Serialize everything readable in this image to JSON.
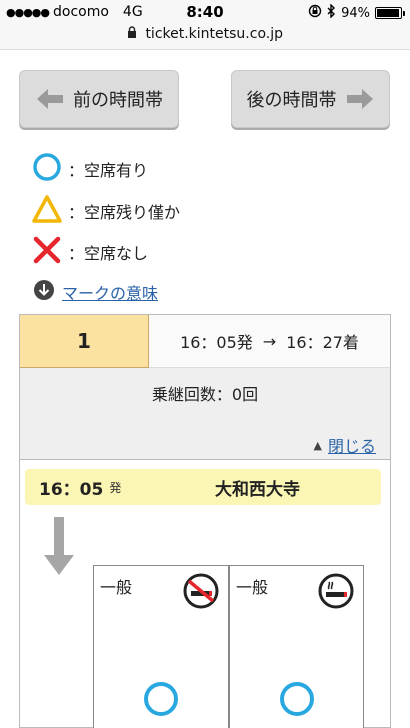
{
  "status_bar": {
    "carrier": "docomo",
    "network": "4G",
    "time": "8:40",
    "battery": "94%",
    "battery_level": 0.94
  },
  "url_bar": {
    "url": "ticket.kintetsu.co.jp"
  },
  "nav": {
    "prev_label": "前の時間帯",
    "next_label": "後の時間帯"
  },
  "legend": {
    "available": "：空席有り",
    "few": "：空席残り僅か",
    "none": "：空席なし",
    "mark_link": "マークの意味"
  },
  "route": {
    "number": "1",
    "departure": "16：05発",
    "arrow": "→",
    "arrival": "16：27着",
    "transfers": "乗継回数：0回",
    "close_label": "閉じる"
  },
  "station": {
    "time": "16：05",
    "suffix": "発",
    "name": "大和西大寺"
  },
  "seats": [
    {
      "label": "一般",
      "smoking": "non-smoking",
      "status": "available"
    },
    {
      "label": "一般",
      "smoking": "smoking",
      "status": "available"
    }
  ],
  "colors": {
    "available": "#29a8e0",
    "few": "#f2b705",
    "none": "#e5262c",
    "link": "#2a62a8",
    "route_highlight": "#fbe2a0",
    "station_highlight": "#fbf6b4"
  }
}
